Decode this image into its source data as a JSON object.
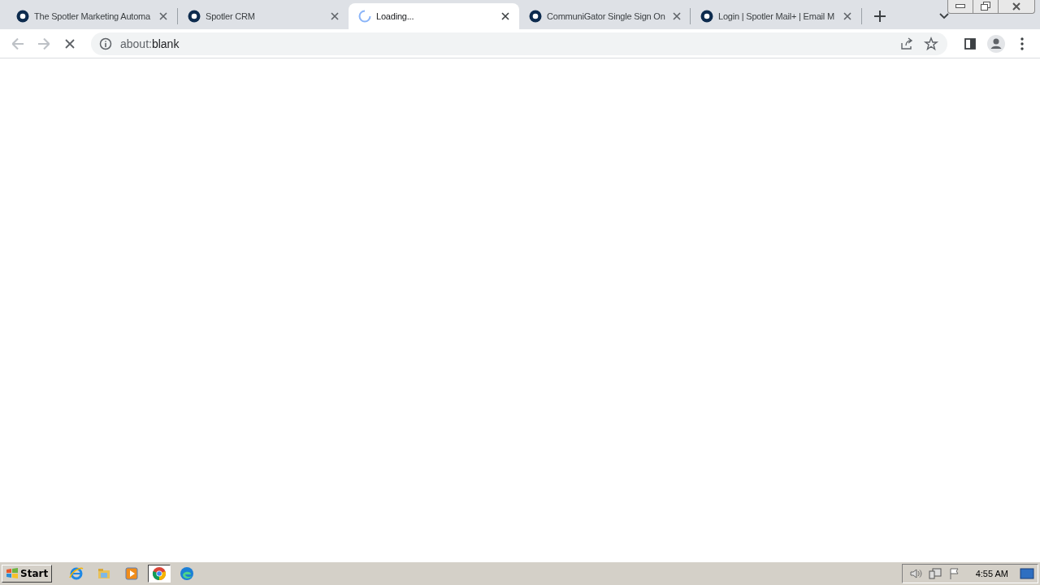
{
  "tabs": [
    {
      "kind": "site",
      "title": "The Spotler Marketing Automa",
      "selected": false
    },
    {
      "kind": "site",
      "title": "Spotler CRM",
      "selected": false
    },
    {
      "kind": "loading",
      "title": "Loading...",
      "selected": true
    },
    {
      "kind": "site",
      "title": "CommuniGator Single Sign On",
      "selected": false
    },
    {
      "kind": "site",
      "title": "Login | Spotler Mail+ | Email M",
      "selected": false
    }
  ],
  "nav_buttons": [
    {
      "kind": "back",
      "disabled": true
    },
    {
      "kind": "forward",
      "disabled": true
    },
    {
      "kind": "stop",
      "disabled": false
    }
  ],
  "address": {
    "scheme": "about:",
    "rest": "blank"
  },
  "taskbar": {
    "start": "Start",
    "apps": [
      {
        "kind": "ie",
        "selected": false
      },
      {
        "kind": "folder",
        "selected": false
      },
      {
        "kind": "media",
        "selected": false
      },
      {
        "kind": "chrome",
        "selected": true
      },
      {
        "kind": "edge",
        "selected": false
      }
    ],
    "clock": "4:55 AM"
  }
}
